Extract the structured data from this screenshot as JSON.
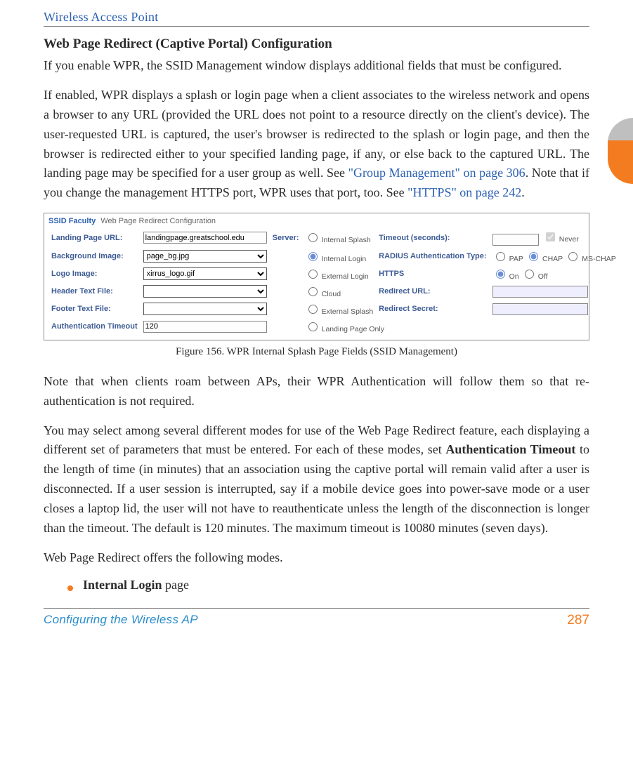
{
  "running_head": "Wireless Access Point",
  "section_heading": "Web Page Redirect (Captive Portal) Configuration",
  "p1": "If you enable WPR, the SSID Management window displays additional fields that must be configured.",
  "p2_a": "If enabled, WPR displays a splash or login page when a client associates to the wireless network and opens a browser to any URL (provided the URL does not point to a resource directly on the client's device). The user-requested URL is captured, the user's browser is redirected to the splash or login page, and then the browser is redirected either to your specified landing page, if any, or else back to the captured URL. The landing page may be specified for a user group as well. See ",
  "p2_link1": "\"Group Management\" on page 306",
  "p2_b": ". Note that if you change the management HTTPS port, WPR uses that port, too. See ",
  "p2_link2": "\"HTTPS\" on page 242",
  "p2_c": ".",
  "figure": {
    "breadcrumb_a": "SSID Faculty",
    "breadcrumb_b": "Web Page Redirect Configuration",
    "labels": {
      "landing": "Landing Page URL:",
      "background": "Background Image:",
      "logo": "Logo Image:",
      "header": "Header Text File:",
      "footer": "Footer Text File:",
      "authto": "Authentication Timeout",
      "server": "Server:",
      "timeout": "Timeout (seconds):",
      "rauth": "RADIUS Authentication Type:",
      "https": "HTTPS",
      "redir_url": "Redirect URL:",
      "redir_secret": "Redirect Secret:"
    },
    "values": {
      "landing": "landingpage.greatschool.edu",
      "background": "page_bg.jpg",
      "logo": "xirrus_logo.gif",
      "header": "",
      "footer": "",
      "authto": "120"
    },
    "server_opts": [
      "Internal Splash",
      "Internal Login",
      "External Login",
      "Cloud",
      "External Splash",
      "Landing Page Only"
    ],
    "never": "Never",
    "rauth_opts": [
      "PAP",
      "CHAP",
      "MS-CHAP"
    ],
    "https_opts": [
      "On",
      "Off"
    ]
  },
  "figcaption": "Figure 156. WPR Internal Splash Page Fields (SSID Management)",
  "p3": "Note that when clients roam between APs, their WPR Authentication will follow them so that re-authentication is not required.",
  "p4_a": "You may select among several different modes for use of the Web Page Redirect feature, each displaying a different set of parameters that must be entered. For each of these modes, set ",
  "p4_strong": "Authentication Timeout",
  "p4_b": " to the length of time (in minutes) that an association using the captive portal will remain valid after a user is disconnected. If a user session is interrupted, say if a mobile device goes into power-save mode or a user closes a laptop lid, the user will not have to reauthenticate unless the length of the disconnection is longer than the timeout. The default is 120 minutes. The maximum timeout is 10080 minutes (seven days).",
  "p5": "Web Page Redirect offers the following modes.",
  "bullet1_strong": "Internal Login",
  "bullet1_rest": " page",
  "footer_left": "Configuring the Wireless AP",
  "footer_right": "287"
}
